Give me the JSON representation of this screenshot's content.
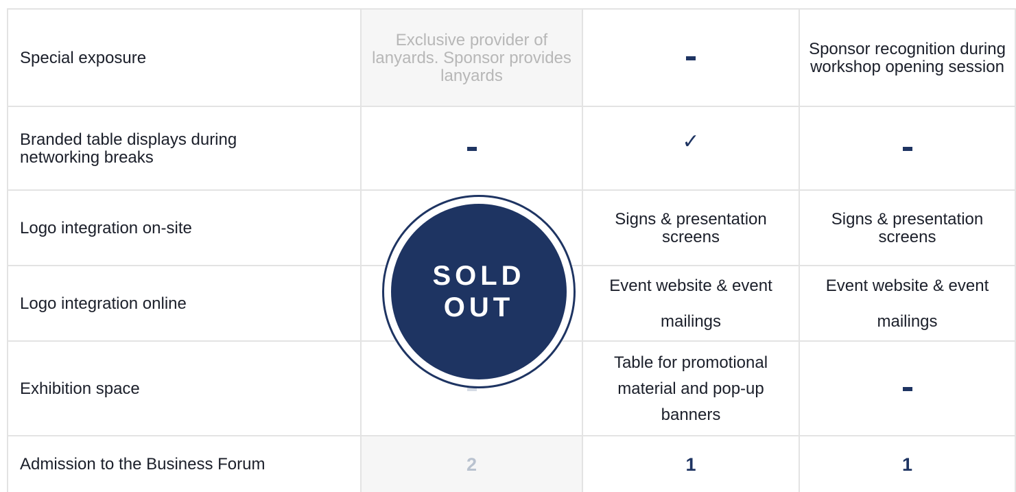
{
  "rows": [
    {
      "label": "Special exposure",
      "col1": "Exclusive provider of lanyards.  Sponsor provides lanyards",
      "col2": "-",
      "col3": "Sponsor recognition during workshop opening session"
    },
    {
      "label": "Branded table displays during networking breaks",
      "col1": "-",
      "col2": "✓",
      "col3": "-"
    },
    {
      "label": "Logo integration on-site",
      "col1": "",
      "col2": "Signs & presentation screens",
      "col3": "Signs & presentation screens"
    },
    {
      "label": "Logo integration online",
      "col1": "",
      "col2": "Event website & event mailings",
      "col3": "Event website & event mailings"
    },
    {
      "label": "Exhibition space",
      "col1": "-",
      "col2": "Table for promotional material and pop-up banners",
      "col3": "-"
    },
    {
      "label": "Admission to the Business Forum",
      "col1": "2",
      "col2": "1",
      "col3": "1"
    }
  ],
  "badge": {
    "line1": "SOLD",
    "line2": "OUT"
  },
  "colors": {
    "navy": "#1e3462",
    "border": "#e3e3e3",
    "muted_column_bg": "#f6f6f6",
    "muted_text": "#b7b7b7"
  },
  "icons": {
    "dash": "dash-icon",
    "check": "checkmark-icon"
  }
}
